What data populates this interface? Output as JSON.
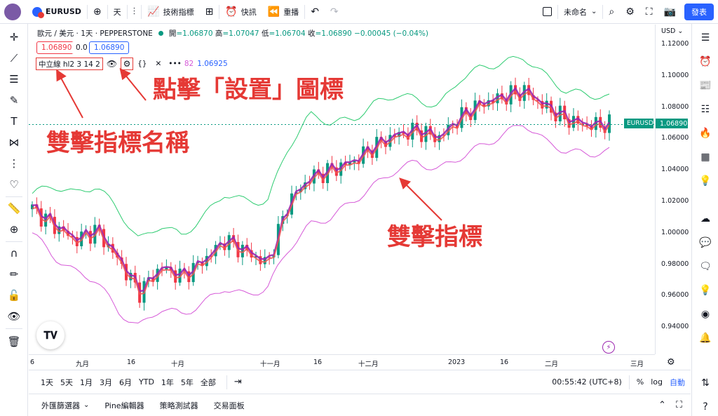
{
  "toolbar": {
    "symbol": "EURUSD",
    "interval": "天",
    "indicators_label": "技術指標",
    "alert_label": "快訊",
    "replay_label": "重播",
    "layout_name": "未命名",
    "publish_label": "發表"
  },
  "legend": {
    "title": "歐元 / 美元 · 1天 · PEPPERSTONE",
    "open_label": "開",
    "open": "=1.06870",
    "high_label": "高",
    "high": "=1.07047",
    "low_label": "低",
    "low": "=1.06704",
    "close_label": "收",
    "close": "=1.06890",
    "change": "−0.00045 (−0.04%)",
    "bid": "1.06890",
    "spread": "0.0",
    "ask": "1.06890"
  },
  "indicator": {
    "name": "中立線 hl2 3 14 2",
    "value_hidden": "82",
    "value": "1.06925"
  },
  "annotations": {
    "settings_hint": "點擊「設置」圖標",
    "name_hint": "雙擊指標名稱",
    "indicator_hint": "雙擊指標"
  },
  "price_axis": {
    "currency": "USD",
    "ticks": [
      "1.12000",
      "1.10000",
      "1.08000",
      "1.06000",
      "1.04000",
      "1.02000",
      "1.00000",
      "0.98000",
      "0.96000",
      "0.94000"
    ],
    "last_label": "EURUSD",
    "last_price": "1.06890"
  },
  "time_axis": {
    "ticks": [
      "6",
      "九月",
      "16",
      "十月",
      "十一月",
      "16",
      "十二月",
      "2023",
      "16",
      "二月",
      "三月"
    ]
  },
  "ranges": [
    "1天",
    "5天",
    "1月",
    "3月",
    "6月",
    "YTD",
    "1年",
    "5年",
    "全部"
  ],
  "status": {
    "clock": "00:55:42 (UTC+8)",
    "percent": "%",
    "log": "log",
    "auto": "自動"
  },
  "bottom_tabs": [
    "外匯篩選器",
    "Pine編輯器",
    "策略測試器",
    "交易面板"
  ],
  "colors": {
    "accent": "#2962ff",
    "up": "#089981",
    "down": "#f23645",
    "annotation": "#e53935",
    "upper_band": "#2ecc71",
    "lower_band": "#d65ad8"
  },
  "chart_data": {
    "type": "line",
    "description_series": [
      {
        "name": "",
        "kind": "candlestick",
        "x": [
          "2022-08-26",
          "2022-09-01",
          "2022-09-09",
          "2022-09-16",
          "2022-09-23",
          "2022-09-28",
          "2022-10-03",
          "2022-10-10",
          "2022-10-17",
          "2022-10-24",
          "2022-10-31",
          "2022-11-04",
          "2022-11-10",
          "2022-11-16",
          "2022-11-23",
          "2022-12-01",
          "2022-12-08",
          "2022-12-15",
          "2022-12-22",
          "2023-01-03",
          "2023-01-10",
          "2023-01-16",
          "2023-01-24",
          "2023-02-01",
          "2023-02-06",
          "2023-02-13",
          "2023-02-20",
          "2023-02-24"
        ],
        "close": [
          1.015,
          1.005,
          0.995,
          1.002,
          0.983,
          0.962,
          0.978,
          0.972,
          0.982,
          0.995,
          0.988,
          0.98,
          1.02,
          1.035,
          1.04,
          1.045,
          1.055,
          1.062,
          1.065,
          1.06,
          1.073,
          1.082,
          1.086,
          1.09,
          1.08,
          1.072,
          1.068,
          1.0689
        ]
      }
    ],
    "upper_band_y": [
      1.025,
      1.03,
      1.025,
      1.03,
      1.015,
      0.995,
      1.005,
      0.998,
      1.01,
      1.025,
      1.02,
      1.02,
      1.055,
      1.075,
      1.07,
      1.072,
      1.082,
      1.088,
      1.085,
      1.08,
      1.098,
      1.105,
      1.108,
      1.112,
      1.1,
      1.09,
      1.088,
      1.086
    ],
    "lower_band_y": [
      1.0,
      0.985,
      0.975,
      0.97,
      0.95,
      0.94,
      0.952,
      0.948,
      0.955,
      0.965,
      0.96,
      0.965,
      0.99,
      1.005,
      1.01,
      1.02,
      1.03,
      1.04,
      1.045,
      1.04,
      1.048,
      1.055,
      1.062,
      1.07,
      1.058,
      1.052,
      1.05,
      1.052
    ],
    "ylim": [
      0.93,
      1.125
    ]
  }
}
